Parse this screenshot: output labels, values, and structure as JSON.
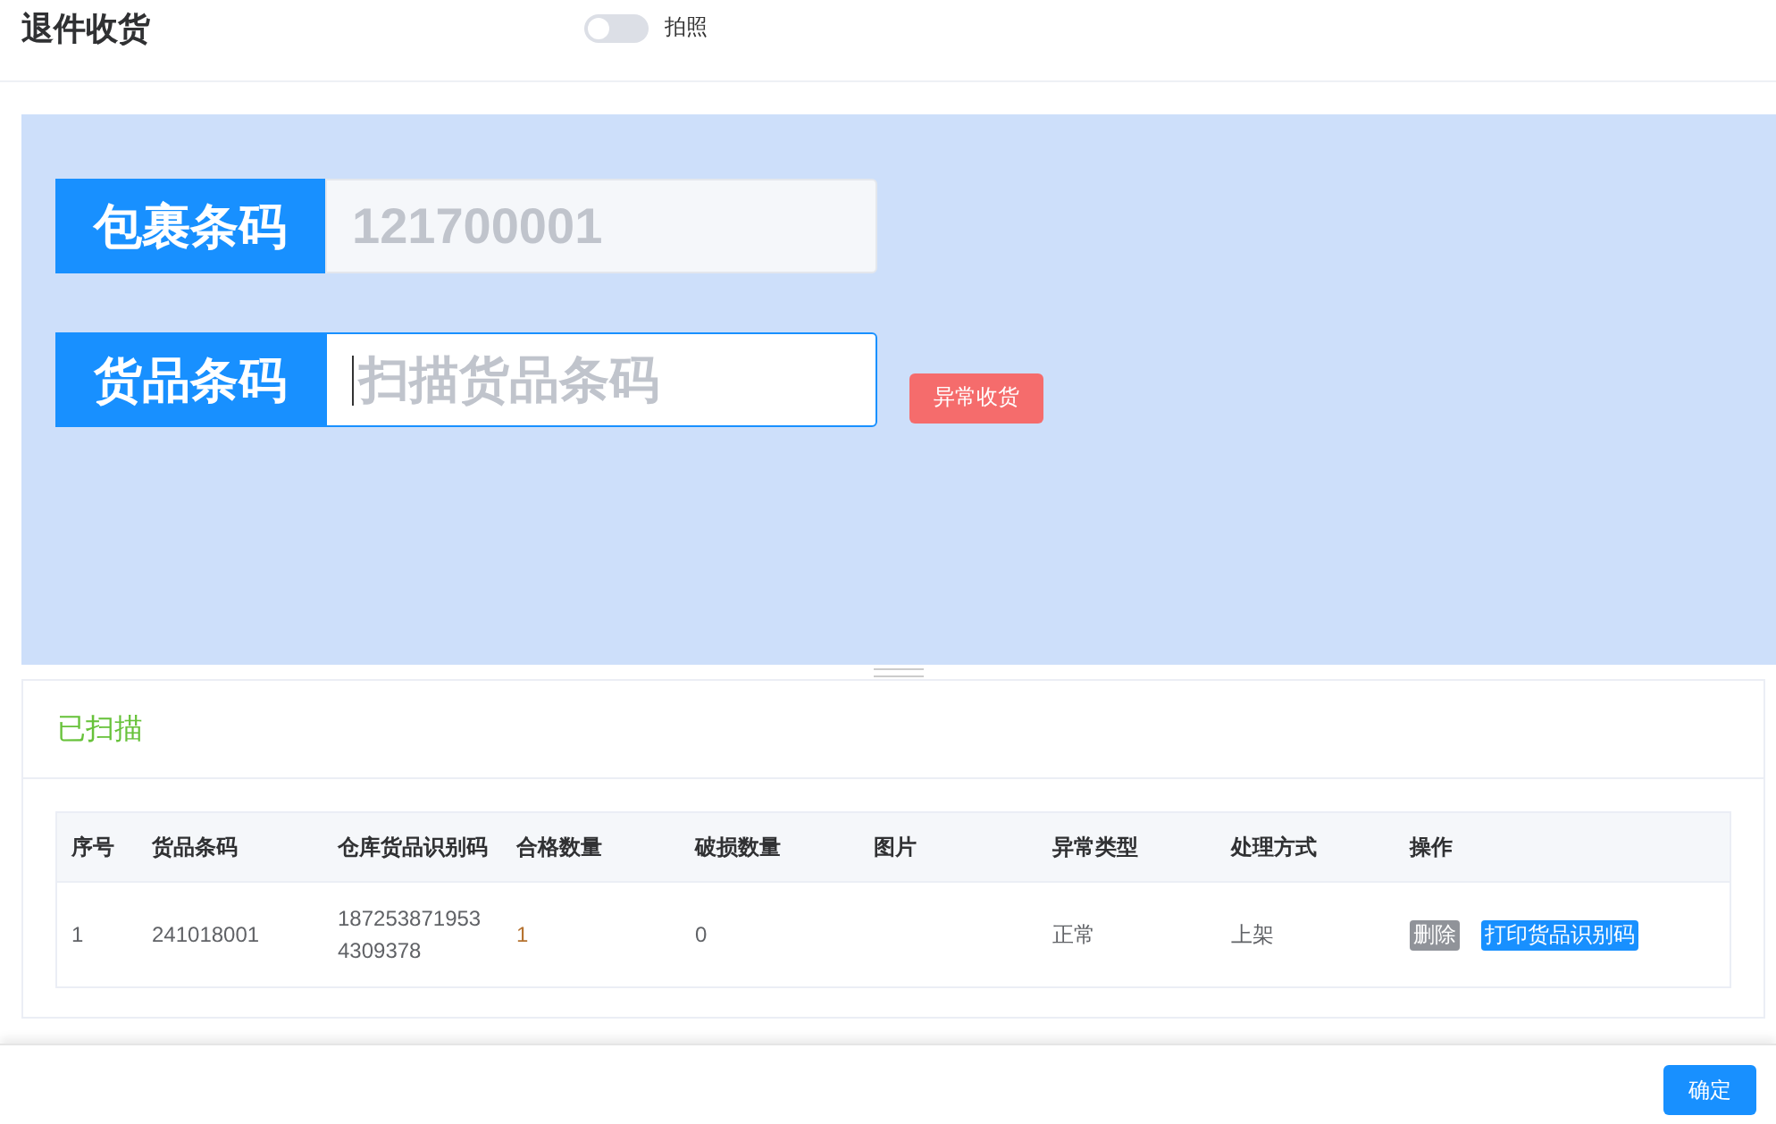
{
  "header": {
    "title": "退件收货",
    "photo_switch": {
      "label": "拍照",
      "on": false
    }
  },
  "scan_panel": {
    "fields": [
      {
        "label": "包裹条码",
        "value": "121700001",
        "disabled": true
      },
      {
        "label": "货品条码",
        "placeholder": "扫描货品条码",
        "disabled": false
      }
    ],
    "exception_button": "异常收货"
  },
  "scanned": {
    "title": "已扫描",
    "table": {
      "columns": [
        "序号",
        "货品条码",
        "仓库货品识别码",
        "合格数量",
        "破损数量",
        "图片",
        "异常类型",
        "处理方式",
        "操作"
      ],
      "rows": [
        {
          "cells": [
            "1",
            "241018001",
            "1872538719534309378",
            "1",
            "0",
            "",
            "正常",
            "上架"
          ],
          "actions": [
            "删除",
            "打印货品识别码"
          ]
        }
      ]
    }
  },
  "footer": {
    "confirm_button": "确定"
  }
}
